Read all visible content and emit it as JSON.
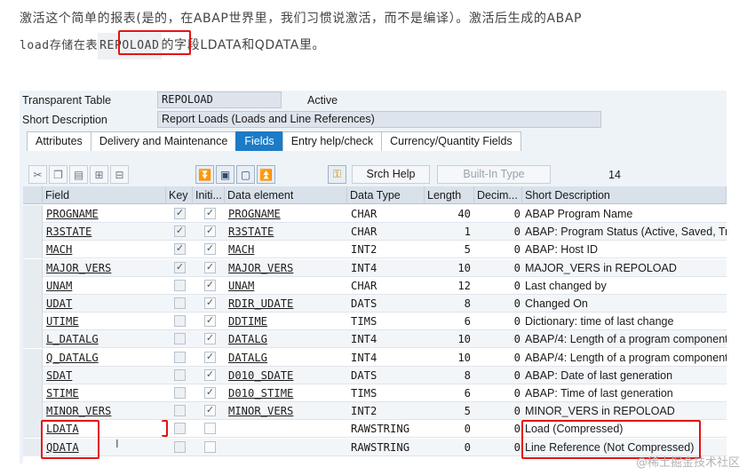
{
  "intro": {
    "line1": "激活这个简单的报表(是的，在ABAP世界里，我们习惯说激活，而不是编译）。激活后生成的ABAP",
    "line2_prefix": "load存储在表",
    "line2_highlight": "REPOLOAD",
    "line2_suffix": "的字段LDATA和QDATA里。"
  },
  "header": {
    "table_type_label": "Transparent Table",
    "table_name": "REPOLOAD",
    "status": "Active",
    "short_desc_label": "Short Description",
    "short_desc_value": "Report Loads (Loads and Line References)"
  },
  "tabs": [
    {
      "label": "Attributes",
      "active": false
    },
    {
      "label": "Delivery and Maintenance",
      "active": false
    },
    {
      "label": "Fields",
      "active": true
    },
    {
      "label": "Entry help/check",
      "active": false
    },
    {
      "label": "Currency/Quantity Fields",
      "active": false
    }
  ],
  "toolbar": {
    "srch_help": "Srch Help",
    "built_in_type": "Built-In Type",
    "count": "14",
    "icons": [
      "cut-icon",
      "copy-icon",
      "paste-icon",
      "insert-row-icon",
      "delete-row-icon",
      "expand-all-icon",
      "select-icon",
      "deselect-icon",
      "collapse-all-icon",
      "key-icon"
    ]
  },
  "columns": [
    "Field",
    "Key",
    "Initi...",
    "Data element",
    "Data Type",
    "Length",
    "Decim...",
    "Short Description"
  ],
  "rows": [
    {
      "field": "PROGNAME",
      "key": true,
      "init": true,
      "element": "PROGNAME",
      "type": "CHAR",
      "length": "40",
      "dec": "0",
      "desc": "ABAP Program Name"
    },
    {
      "field": "R3STATE",
      "key": true,
      "init": true,
      "element": "R3STATE",
      "type": "CHAR",
      "length": "1",
      "dec": "0",
      "desc": "ABAP: Program Status (Active, Saved, Tr"
    },
    {
      "field": "MACH",
      "key": true,
      "init": true,
      "element": "MACH",
      "type": "INT2",
      "length": "5",
      "dec": "0",
      "desc": "ABAP: Host ID"
    },
    {
      "field": "MAJOR_VERS",
      "key": true,
      "init": true,
      "element": "MAJOR_VERS",
      "type": "INT4",
      "length": "10",
      "dec": "0",
      "desc": "MAJOR_VERS in REPOLOAD"
    },
    {
      "field": "UNAM",
      "key": false,
      "init": true,
      "element": "UNAM",
      "type": "CHAR",
      "length": "12",
      "dec": "0",
      "desc": "Last changed by"
    },
    {
      "field": "UDAT",
      "key": false,
      "init": true,
      "element": "RDIR_UDATE",
      "type": "DATS",
      "length": "8",
      "dec": "0",
      "desc": "Changed On"
    },
    {
      "field": "UTIME",
      "key": false,
      "init": true,
      "element": "DDTIME",
      "type": "TIMS",
      "length": "6",
      "dec": "0",
      "desc": "Dictionary: time of last change"
    },
    {
      "field": "L_DATALG",
      "key": false,
      "init": true,
      "element": "DATALG",
      "type": "INT4",
      "length": "10",
      "dec": "0",
      "desc": "ABAP/4: Length of a program component"
    },
    {
      "field": "Q_DATALG",
      "key": false,
      "init": true,
      "element": "DATALG",
      "type": "INT4",
      "length": "10",
      "dec": "0",
      "desc": "ABAP/4: Length of a program component"
    },
    {
      "field": "SDAT",
      "key": false,
      "init": true,
      "element": "D010_SDATE",
      "type": "DATS",
      "length": "8",
      "dec": "0",
      "desc": "ABAP: Date of last generation"
    },
    {
      "field": "STIME",
      "key": false,
      "init": true,
      "element": "D010_STIME",
      "type": "TIMS",
      "length": "6",
      "dec": "0",
      "desc": "ABAP: Time of last generation"
    },
    {
      "field": "MINOR_VERS",
      "key": false,
      "init": true,
      "element": "MINOR_VERS",
      "type": "INT2",
      "length": "5",
      "dec": "0",
      "desc": "MINOR_VERS in REPOLOAD"
    },
    {
      "field": "LDATA",
      "key": false,
      "init": false,
      "element": "",
      "type": "RAWSTRING",
      "length": "0",
      "dec": "0",
      "desc": "Load (Compressed)"
    },
    {
      "field": "QDATA",
      "key": false,
      "init": false,
      "element": "",
      "type": "RAWSTRING",
      "length": "0",
      "dec": "0",
      "desc": "Line Reference (Not Compressed)"
    }
  ],
  "cursor_glyph": "I",
  "check_glyph": "✓",
  "watermark": "@稀土掘金技术社区",
  "colors": {
    "active_tab": "#1b7bc7",
    "highlight_box": "#e31414"
  }
}
